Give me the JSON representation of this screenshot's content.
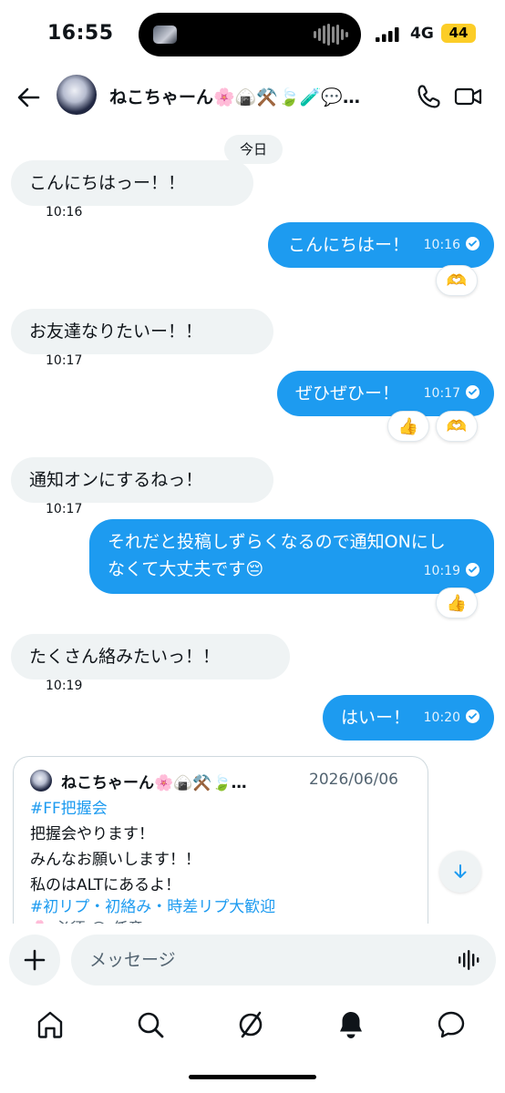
{
  "status_bar": {
    "time": "16:55",
    "network": "4G",
    "battery": "44"
  },
  "header": {
    "contact_name": "ねこちゃーん🌸🍙⚒️🍃🧪💬…"
  },
  "conversation": {
    "date_label": "今日",
    "messages": [
      {
        "dir": "in",
        "text": "こんにちはっー！！",
        "time": "10:16"
      },
      {
        "dir": "out",
        "text": "こんにちはー！",
        "time": "10:16",
        "reactions": [
          "🫶"
        ]
      },
      {
        "dir": "in",
        "text": "お友達なりたいー！！",
        "time": "10:17"
      },
      {
        "dir": "out",
        "text": "ぜひぜひー！",
        "time": "10:17",
        "reactions": [
          "👍",
          "🫶"
        ]
      },
      {
        "dir": "in",
        "text": "通知オンにするねっ！",
        "time": "10:17"
      },
      {
        "dir": "out",
        "text_line1": "それだと投稿しずらくなるので通知ONにし",
        "text_line2": "なくて大丈夫です😔",
        "time": "10:19",
        "reactions": [
          "👍"
        ]
      },
      {
        "dir": "in",
        "text": "たくさん絡みたいっ！！",
        "time": "10:19"
      },
      {
        "dir": "out",
        "text": "はいー！",
        "time": "10:20"
      }
    ]
  },
  "shared_post": {
    "author": "ねこちゃーん🌸🍙⚒️🍃…",
    "date": "2026/06/06",
    "lines": [
      "#FF把握会",
      "把握会やります！",
      "みんなお願いします！！",
      "私のはALTにあるよ！",
      "#初リプ・初絡み・時差リプ大歓迎",
      "🌸 必須 ◯ 任意"
    ]
  },
  "composer": {
    "placeholder": "メッセージ"
  },
  "colors": {
    "accent": "#1d9bf0",
    "incoming_bubble": "#eff3f4",
    "text": "#0f1419",
    "muted": "#536471"
  },
  "icons": [
    "back-arrow-icon",
    "phone-icon",
    "video-icon",
    "check-icon",
    "arrow-down-icon",
    "plus-icon",
    "voice-icon",
    "home-icon",
    "search-icon",
    "grok-icon",
    "bell-icon",
    "messages-icon"
  ]
}
